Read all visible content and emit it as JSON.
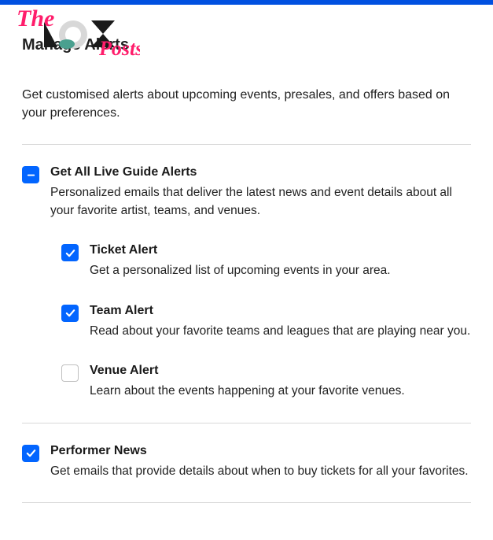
{
  "header": {
    "title": "Manage Alerts",
    "logo_text_top": "The",
    "logo_text_bottom": "Posts"
  },
  "intro": "Get customised alerts about upcoming events, presales, and offers based on your preferences.",
  "alerts": {
    "all": {
      "title": "Get All Live Guide Alerts",
      "desc": "Personalized emails that deliver the latest news and event details about all your favorite artist, teams, and venues.",
      "state": "indeterminate"
    },
    "ticket": {
      "title": "Ticket Alert",
      "desc": "Get a personalized list of upcoming events in your area.",
      "state": "checked"
    },
    "team": {
      "title": "Team Alert",
      "desc": "Read about your favorite teams and leagues that are playing near you.",
      "state": "checked"
    },
    "venue": {
      "title": "Venue Alert",
      "desc": "Learn about the events happening at your favorite venues.",
      "state": "unchecked"
    },
    "performer": {
      "title": "Performer News",
      "desc": "Get emails that provide details about when to buy tickets for all your favorites.",
      "state": "checked"
    }
  }
}
